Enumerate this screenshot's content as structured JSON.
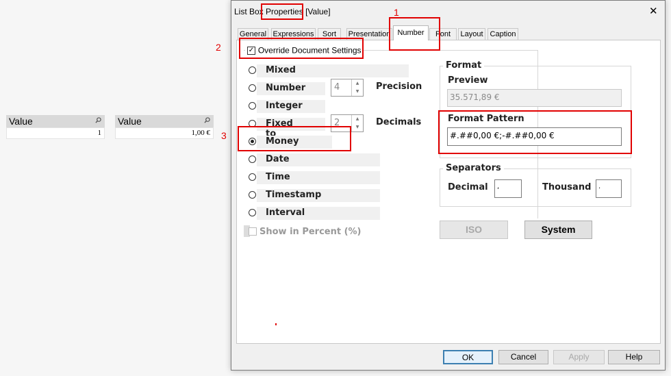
{
  "listboxes": [
    {
      "title": "Value",
      "value": "1"
    },
    {
      "title": "Value",
      "value": "1,00 €"
    }
  ],
  "dialog": {
    "title_prefix": "List Box ",
    "title_highlight": "Properties",
    "title_suffix": " [Value]",
    "close": "✕",
    "tabs": [
      "General",
      "Expressions",
      "Sort",
      "Presentation",
      "Number",
      "Font",
      "Layout",
      "Caption"
    ],
    "active_tab": "Number",
    "override_label": "Override Document Settings",
    "override_checked": true,
    "formats": [
      "Mixed",
      "Number",
      "Integer",
      "Fixed to",
      "Money",
      "Date",
      "Time",
      "Timestamp",
      "Interval"
    ],
    "selected_format": "Money",
    "precision_label": "Precision",
    "precision_value": "4",
    "decimals_label": "Decimals",
    "decimals_value": "2",
    "show_percent_label": "Show in Percent (%)",
    "format_group": "Format",
    "preview_label": "Preview",
    "preview_value": "35.571,89 €",
    "pattern_label": "Format Pattern",
    "pattern_value": "#.##0,00 €;-#.##0,00 €",
    "separators_group": "Separators",
    "decimal_label": "Decimal",
    "decimal_value": ",",
    "thousand_label": "Thousand",
    "thousand_value": ".",
    "iso_button": "ISO",
    "system_button": "System",
    "ok_button": "OK",
    "cancel_button": "Cancel",
    "apply_button": "Apply",
    "help_button": "Help"
  },
  "annotations": {
    "one": "1",
    "two": "2",
    "three": "3"
  },
  "colors": {
    "highlight": "#e10000",
    "dialog_bg": "#f0f0f0",
    "listbox_header": "#d9d9d9"
  }
}
